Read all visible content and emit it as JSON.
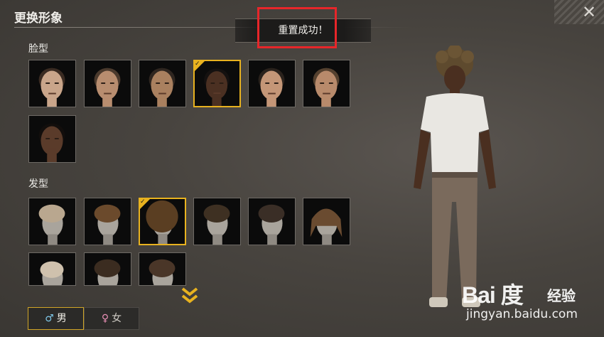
{
  "header": {
    "title": "更换形象",
    "close_icon": "close-icon"
  },
  "toast": {
    "text": "重置成功！"
  },
  "sections": {
    "face": {
      "label": "脸型",
      "selected_index": 3,
      "items": [
        {
          "skin": "#c9a58a",
          "hair": "#3a2b22"
        },
        {
          "skin": "#b88d6f",
          "hair": "#4b3a2d"
        },
        {
          "skin": "#a9805f",
          "hair": "#2f2620"
        },
        {
          "skin": "#4b3022",
          "hair": "#151110"
        },
        {
          "skin": "#c49677",
          "hair": "#2a221c"
        },
        {
          "skin": "#b88a6b",
          "hair": "#55412f"
        },
        {
          "skin": "#5a3b2a",
          "hair": "#120e0c"
        }
      ]
    },
    "hair": {
      "label": "发型",
      "selected_index": 2,
      "items": [
        {
          "hair": "#b9a78f",
          "style": "short"
        },
        {
          "hair": "#6b4a2c",
          "style": "side"
        },
        {
          "hair": "#5a3e22",
          "style": "afro"
        },
        {
          "hair": "#3e3022",
          "style": "curly"
        },
        {
          "hair": "#3a2e26",
          "style": "undercut"
        },
        {
          "hair": "#6a4b30",
          "style": "long"
        },
        {
          "hair": "#cfc1ad",
          "style": "bald"
        },
        {
          "hair": "#3b2c20",
          "style": "slick"
        },
        {
          "hair": "#4a3628",
          "style": "wavy"
        }
      ]
    }
  },
  "scroll_icon": "double-chevron-down-icon",
  "gender": {
    "male": {
      "symbol": "♂",
      "label": "男",
      "selected": true
    },
    "female": {
      "symbol": "♀",
      "label": "女",
      "selected": false
    }
  },
  "watermark": {
    "logo": "Bai 度",
    "brand": "经验",
    "url": "jingyan.baidu.com"
  },
  "colors": {
    "accent": "#e8b21f",
    "highlight": "#e7262a",
    "male": "#7fc7e8",
    "female": "#e98fb5"
  }
}
